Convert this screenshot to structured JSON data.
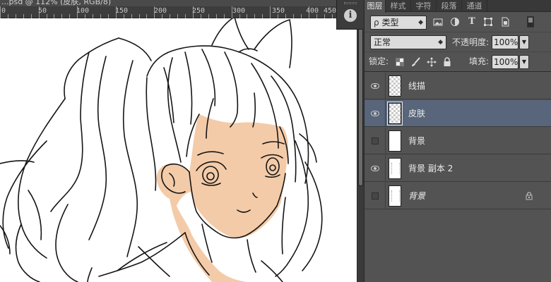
{
  "document": {
    "tab_title": "...psd @ 112% (皮肤, RGB/8)"
  },
  "ruler": {
    "labels": [
      "0",
      "50",
      "100",
      "150",
      "200",
      "250",
      "300",
      "350",
      "400",
      "450"
    ]
  },
  "layers_panel": {
    "tabs": [
      {
        "label": "图层",
        "active": true
      },
      {
        "label": "样式",
        "active": false
      },
      {
        "label": "字符",
        "active": false
      },
      {
        "label": "段落",
        "active": false
      },
      {
        "label": "通道",
        "active": false
      }
    ],
    "filter": {
      "search_glyph": "ρ",
      "kind_value": "类型",
      "icons": [
        "image-filter-icon",
        "adjustment-filter-icon",
        "type-filter-icon",
        "shape-filter-icon",
        "smart-object-filter-icon"
      ]
    },
    "blend": {
      "mode_value": "正常",
      "opacity_label": "不透明度:",
      "opacity_value": "100%"
    },
    "lock": {
      "label": "锁定:",
      "fill_label": "填充:",
      "fill_value": "100%"
    },
    "layers": [
      {
        "name": "线描",
        "visible": true,
        "selected": false,
        "thumbnail": "transparent",
        "locked": false,
        "italic": false
      },
      {
        "name": "皮肤",
        "visible": true,
        "selected": true,
        "thumbnail": "transparent",
        "locked": false,
        "italic": false
      },
      {
        "name": "背景",
        "visible": false,
        "selected": false,
        "thumbnail": "white",
        "locked": false,
        "italic": false
      },
      {
        "name": "背景 副本 2",
        "visible": true,
        "selected": false,
        "thumbnail": "sketch",
        "locked": false,
        "italic": false
      },
      {
        "name": "背景",
        "visible": false,
        "selected": false,
        "thumbnail": "sketch",
        "locked": true,
        "italic": true
      }
    ]
  },
  "colors": {
    "skin_fill": "#f4cba8",
    "line_art": "#151515",
    "panel_bg": "#535353",
    "selected_row": "#58657a"
  }
}
